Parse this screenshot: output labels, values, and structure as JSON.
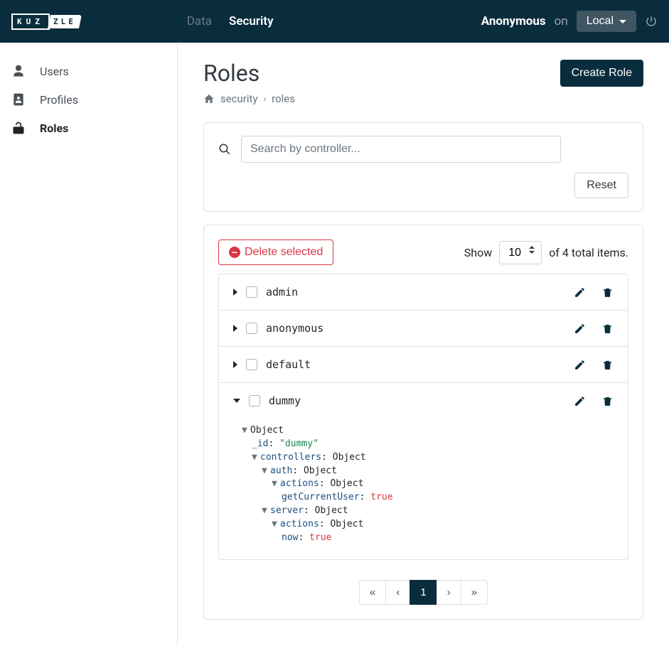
{
  "header": {
    "logo": {
      "left": "KUZ",
      "right": "ZLE"
    },
    "tabs": [
      {
        "label": "Data",
        "active": false
      },
      {
        "label": "Security",
        "active": true
      }
    ],
    "user": "Anonymous",
    "on_label": "on",
    "env": "Local"
  },
  "sidebar": {
    "items": [
      {
        "label": "Users",
        "icon": "user-icon",
        "active": false
      },
      {
        "label": "Profiles",
        "icon": "id-badge-icon",
        "active": false
      },
      {
        "label": "Roles",
        "icon": "unlock-icon",
        "active": true
      }
    ]
  },
  "page": {
    "title": "Roles",
    "breadcrumb": {
      "level1": "security",
      "level2": "roles"
    },
    "create_button": "Create Role"
  },
  "search": {
    "placeholder": "Search by controller...",
    "reset_label": "Reset"
  },
  "list": {
    "delete_button": "Delete selected",
    "show_label": "Show",
    "page_size": "10",
    "total_text": "of 4 total items.",
    "roles": [
      {
        "name": "admin",
        "expanded": false
      },
      {
        "name": "anonymous",
        "expanded": false
      },
      {
        "name": "default",
        "expanded": false
      },
      {
        "name": "dummy",
        "expanded": true
      }
    ],
    "expanded_json": {
      "root_label": "Object",
      "id_key": "_id",
      "id_val": "\"dummy\"",
      "controllers_key": "controllers",
      "obj_label": "Object",
      "auth_key": "auth",
      "actions_key": "actions",
      "getCurrentUser_key": "getCurrentUser",
      "server_key": "server",
      "now_key": "now",
      "true_val": "true"
    }
  },
  "pagination": {
    "first": "«",
    "prev": "‹",
    "current": "1",
    "next": "›",
    "last": "»"
  }
}
